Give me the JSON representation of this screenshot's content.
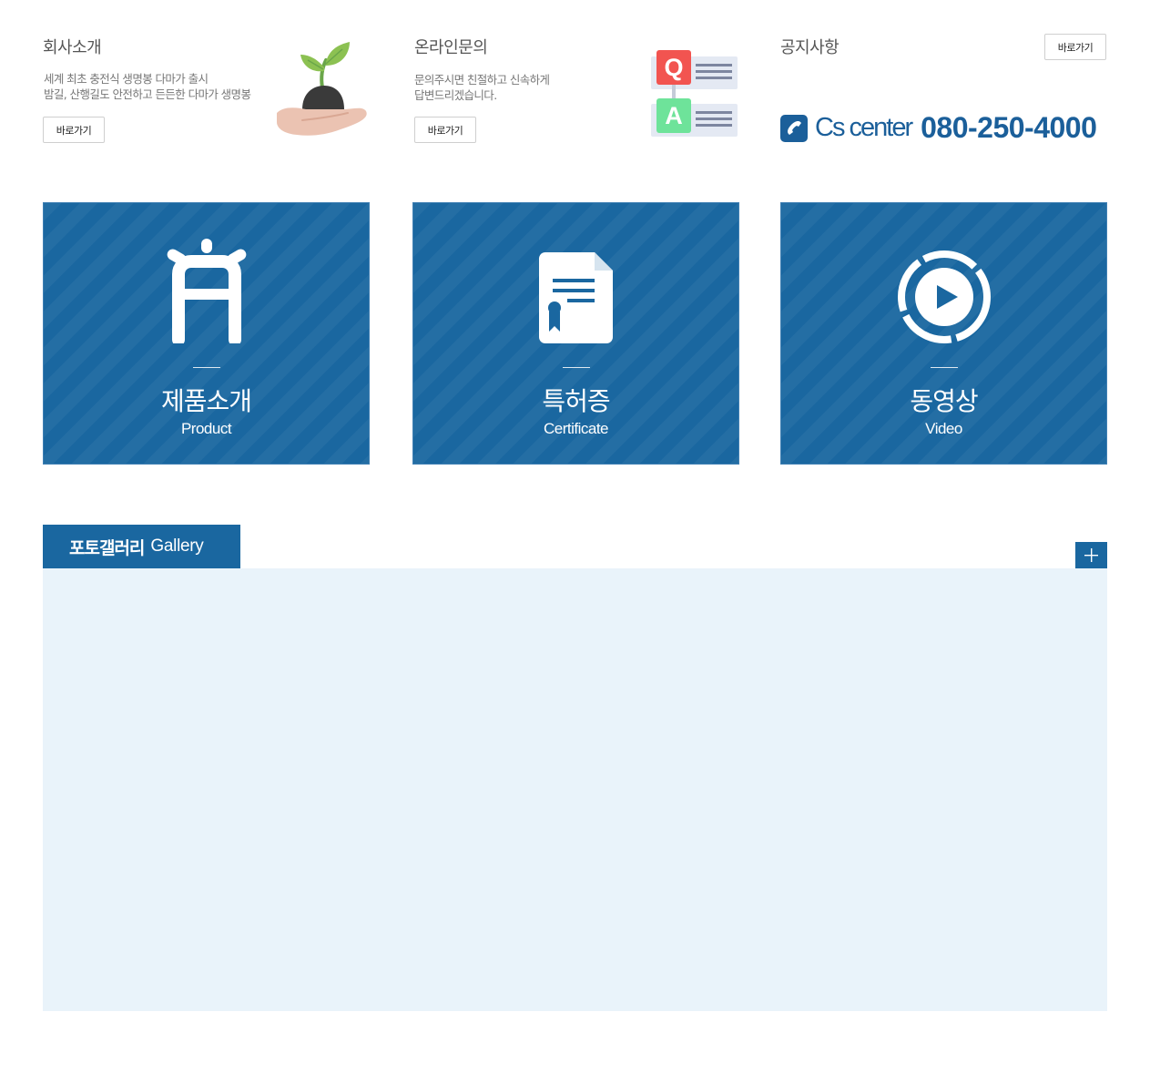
{
  "company": {
    "title": "회사소개",
    "desc_line1": "세계 최초 충전식 생명봉 다마가 출시",
    "desc_line2": "밤길, 산행길도 안전하고 든든한 다마가 생명봉",
    "button": "바로가기",
    "illustration_icon": "plant-in-hand-icon"
  },
  "inquiry": {
    "title": "온라인문의",
    "desc_line1": "문의주시면 친절하고 신속하게",
    "desc_line2": "답변드리겠습니다.",
    "button": "바로가기",
    "q_letter": "Q",
    "a_letter": "A",
    "illustration_icon": "qa-icon"
  },
  "notice": {
    "title": "공지사항",
    "button": "바로가기"
  },
  "cs": {
    "label": "Cs center",
    "number": "080-250-4000",
    "icon": "phone-icon"
  },
  "tiles": [
    {
      "ko": "제품소개",
      "en": "Product",
      "icon": "product-icon"
    },
    {
      "ko": "특허증",
      "en": "Certificate",
      "icon": "certificate-icon"
    },
    {
      "ko": "동영상",
      "en": "Video",
      "icon": "play-icon"
    }
  ],
  "gallery": {
    "title_ko": "포토갤러리",
    "title_en": "Gallery",
    "more_icon": "plus-icon"
  },
  "colors": {
    "brand_blue": "#1a67a0",
    "gallery_bg": "#e9f3fa",
    "q_red": "#f25450",
    "a_green": "#6ee39a"
  }
}
